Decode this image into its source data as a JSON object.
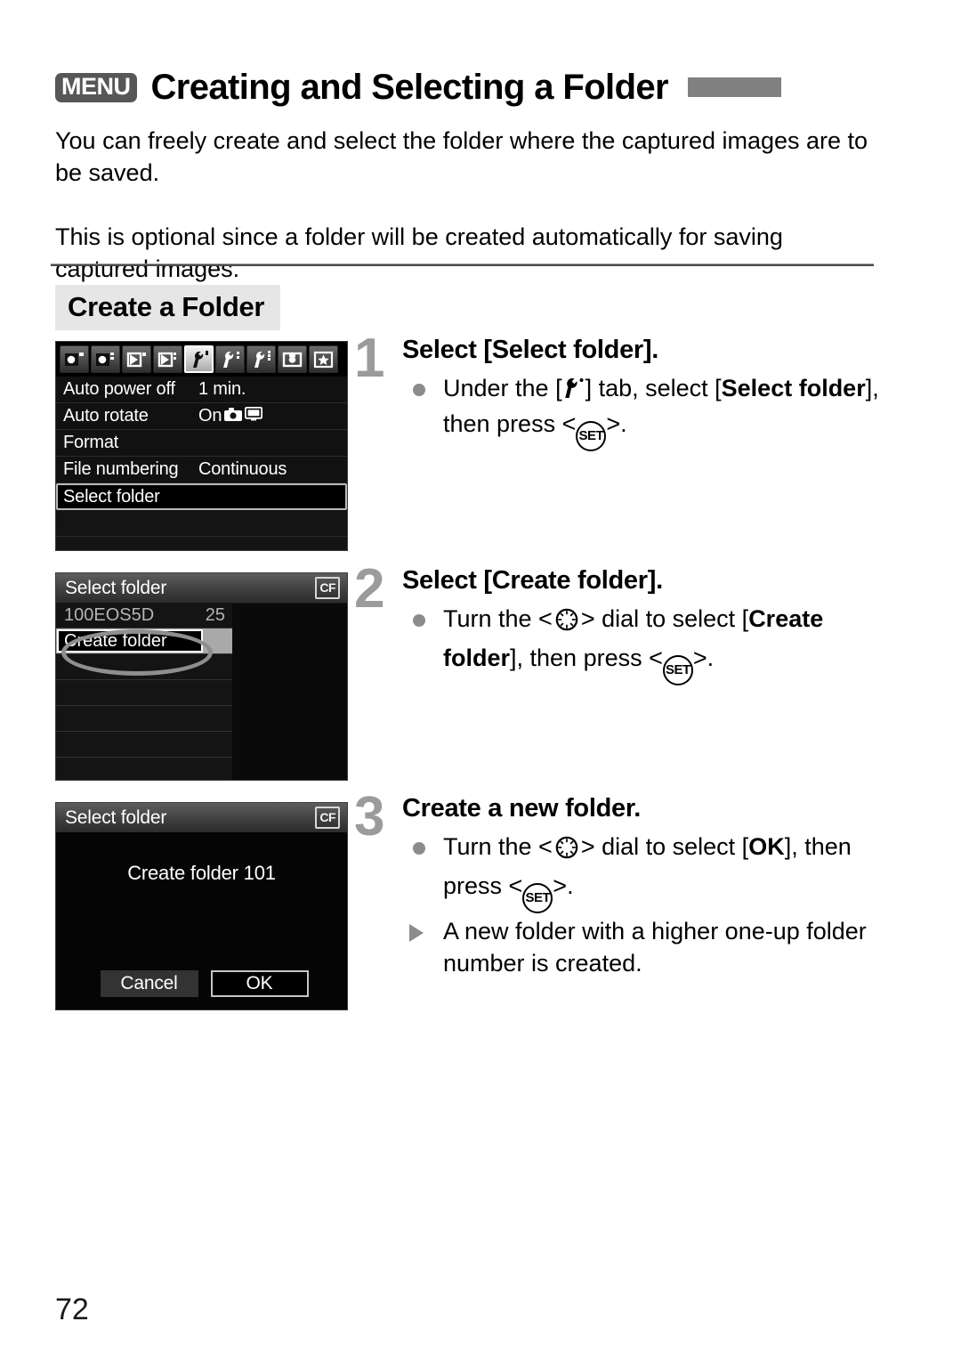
{
  "header": {
    "menu_badge": "MENU",
    "title": "Creating and Selecting a Folder"
  },
  "intro": {
    "paragraph_1": "You can freely create and select the folder where the captured images are to be saved.",
    "paragraph_2": "This is optional since a folder will be created automatically for saving captured images."
  },
  "section": {
    "heading": "Create a Folder"
  },
  "screens": {
    "settings_menu": {
      "tabs": [
        {
          "name": "shooting-1",
          "active": false
        },
        {
          "name": "shooting-2",
          "active": false
        },
        {
          "name": "playback-1",
          "active": false
        },
        {
          "name": "playback-2",
          "active": false
        },
        {
          "name": "setup-1",
          "active": true
        },
        {
          "name": "setup-2",
          "active": false
        },
        {
          "name": "setup-3",
          "active": false
        },
        {
          "name": "custom-functions",
          "active": false
        },
        {
          "name": "my-menu",
          "active": false
        }
      ],
      "rows": [
        {
          "label": "Auto power off",
          "value": "1 min.",
          "selected": false
        },
        {
          "label": "Auto rotate",
          "value": "On",
          "value_icons": [
            "camera-icon",
            "monitor-icon"
          ],
          "selected": false
        },
        {
          "label": "Format",
          "value": "",
          "selected": false
        },
        {
          "label": "File numbering",
          "value": "Continuous",
          "selected": false
        },
        {
          "label": "Select folder",
          "value": "",
          "selected": true
        }
      ]
    },
    "folder_list": {
      "title": "Select folder",
      "card_icon_label": "CF",
      "rows": [
        {
          "label": "100EOS5D",
          "count": "25",
          "highlighted": false
        },
        {
          "label": "Create folder",
          "count": "",
          "highlighted": true
        }
      ],
      "callout": "ellipse-highlight"
    },
    "confirm_dialog": {
      "title": "Select folder",
      "card_icon_label": "CF",
      "message": "Create folder 101",
      "cancel_label": "Cancel",
      "ok_label": "OK"
    }
  },
  "steps": [
    {
      "number": "1",
      "title": "Select [Select folder].",
      "lines": [
        {
          "marker": "dot",
          "segments": [
            {
              "text": "Under the [",
              "bold": false
            },
            {
              "icon": "wrench-setup-tab-icon"
            },
            {
              "text": "] tab, select [",
              "bold": false
            },
            {
              "text": "Select folder",
              "bold": true
            },
            {
              "text": "], then press <",
              "bold": false
            },
            {
              "icon": "set-button-icon"
            },
            {
              "text": ">.",
              "bold": false
            }
          ]
        }
      ]
    },
    {
      "number": "2",
      "title": "Select [Create folder].",
      "lines": [
        {
          "marker": "dot",
          "segments": [
            {
              "text": "Turn the <",
              "bold": false
            },
            {
              "icon": "quick-control-dial-icon"
            },
            {
              "text": "> dial to select [",
              "bold": false
            },
            {
              "text": "Create folder",
              "bold": true
            },
            {
              "text": "], then press <",
              "bold": false
            },
            {
              "icon": "set-button-icon"
            },
            {
              "text": ">.",
              "bold": false
            }
          ]
        }
      ]
    },
    {
      "number": "3",
      "title": "Create a new folder.",
      "lines": [
        {
          "marker": "dot",
          "segments": [
            {
              "text": "Turn the <",
              "bold": false
            },
            {
              "icon": "quick-control-dial-icon"
            },
            {
              "text": "> dial to select [",
              "bold": false
            },
            {
              "text": "OK",
              "bold": true
            },
            {
              "text": "], then press <",
              "bold": false
            },
            {
              "icon": "set-button-icon"
            },
            {
              "text": ">.",
              "bold": false
            }
          ]
        },
        {
          "marker": "triangle",
          "segments": [
            {
              "text": "A new folder with a higher one-up folder number is created.",
              "bold": false
            }
          ]
        }
      ]
    }
  ],
  "footer": {
    "page_number": "72"
  },
  "colors": {
    "accent_gray": "#808080",
    "step_number_gray": "#9b9b9b",
    "section_bg": "#e6e6e6",
    "badge_bg": "#575757"
  }
}
